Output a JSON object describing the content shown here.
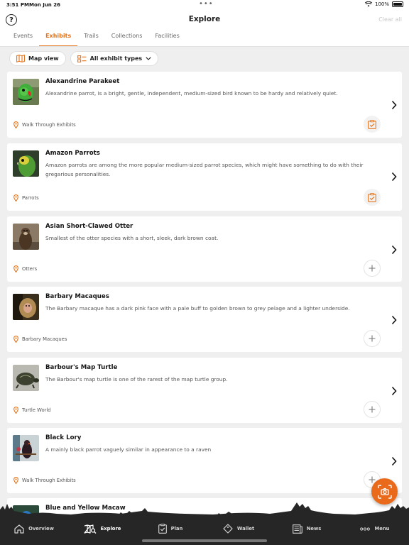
{
  "status": {
    "time": "3:51 PM",
    "date": "Mon Jun 26",
    "battery": "100%"
  },
  "header": {
    "title": "Explore",
    "help": "?",
    "clear_all": "Clear all"
  },
  "tabs": [
    {
      "label": "Events"
    },
    {
      "label": "Exhibits",
      "active": true
    },
    {
      "label": "Trails"
    },
    {
      "label": "Collections"
    },
    {
      "label": "Facilities"
    }
  ],
  "filters": {
    "map_view": "Map view",
    "exhibit_types": "All exhibit types"
  },
  "exhibits": [
    {
      "title": "Alexandrine Parakeet",
      "description": "Alexandrine parrot, is a bright, gentle, independent, medium-sized bird known to be hardy and relatively quiet.",
      "location": "Walk Through Exhibits",
      "action": "planned",
      "thumb": "parakeet"
    },
    {
      "title": "Amazon Parrots",
      "description": "Amazon parrots are among the more popular medium-sized parrot species, which might have something to do with their gregarious personalities.",
      "location": "Parrots",
      "action": "planned",
      "thumb": "parrot"
    },
    {
      "title": "Asian Short-Clawed Otter",
      "description": "Smallest of the otter species with a short, sleek, dark brown coat.",
      "location": "Otters",
      "action": "add",
      "thumb": "otter"
    },
    {
      "title": "Barbary Macaques",
      "description": "The Barbary macaque has a dark pink face with a pale buff to golden brown to grey pelage and a lighter underside.",
      "location": "Barbary Macaques",
      "action": "add",
      "thumb": "macaque"
    },
    {
      "title": "Barbour's Map Turtle",
      "description": "The Barbour's map turtle is one of the rarest of the map turtle group.",
      "location": "Turtle World",
      "action": "add",
      "thumb": "turtle"
    },
    {
      "title": "Black Lory",
      "description": "A mainly black parrot vaguely similar in appearance to a raven",
      "location": "Walk Through Exhibits",
      "action": "add",
      "thumb": "lory"
    },
    {
      "title": "Blue and Yellow Macaw",
      "description": "",
      "location": "",
      "action": "",
      "thumb": "macaw"
    }
  ],
  "tabbar": [
    {
      "label": "Overview",
      "icon": "home-icon"
    },
    {
      "label": "Explore",
      "icon": "map-search-icon",
      "active": true
    },
    {
      "label": "Plan",
      "icon": "clipboard-icon"
    },
    {
      "label": "Wallet",
      "icon": "ticket-icon"
    },
    {
      "label": "News",
      "icon": "news-icon"
    },
    {
      "label": "Menu",
      "icon": "more-icon"
    }
  ],
  "colors": {
    "accent": "#e4731a",
    "fab": "#e96a1a",
    "tabbar": "#262626"
  }
}
